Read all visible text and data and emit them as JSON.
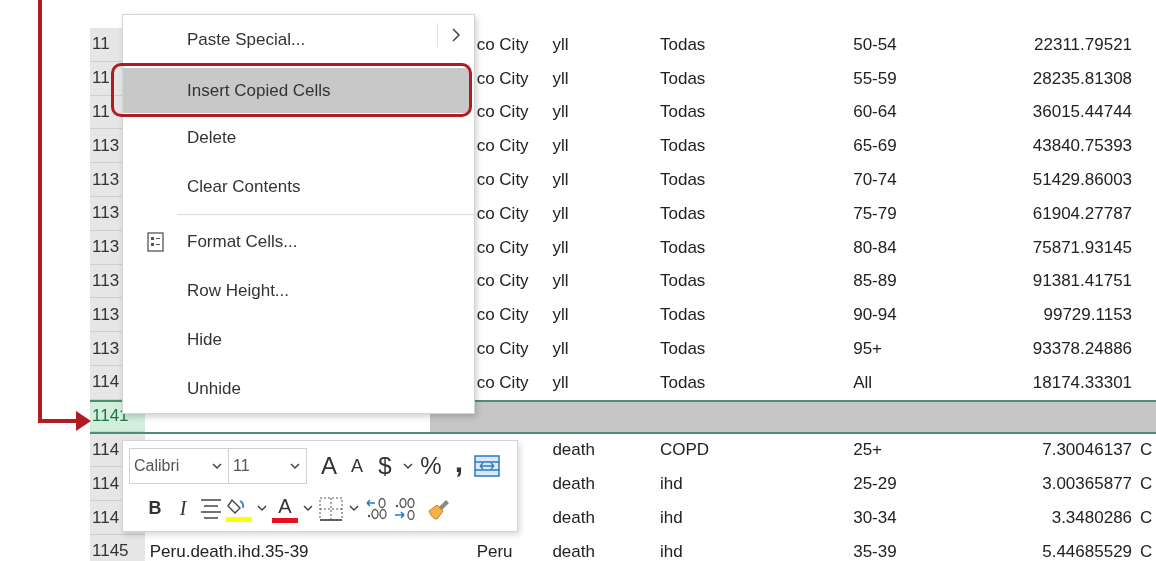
{
  "rows": [
    {
      "header": "11",
      "selected": false,
      "column_c": "co City",
      "column_d": "yll",
      "column_e": "Todas",
      "column_f": "50-54",
      "column_g": "22311.79521"
    },
    {
      "header": "11",
      "selected": false,
      "column_c": "co City",
      "column_d": "yll",
      "column_e": "Todas",
      "column_f": "55-59",
      "column_g": "28235.81308"
    },
    {
      "header": "11",
      "selected": false,
      "column_c": "co City",
      "column_d": "yll",
      "column_e": "Todas",
      "column_f": "60-64",
      "column_g": "36015.44744"
    },
    {
      "header": "113",
      "selected": false,
      "column_c": "co City",
      "column_d": "yll",
      "column_e": "Todas",
      "column_f": "65-69",
      "column_g": "43840.75393"
    },
    {
      "header": "113",
      "selected": false,
      "column_c": "co City",
      "column_d": "yll",
      "column_e": "Todas",
      "column_f": "70-74",
      "column_g": "51429.86003"
    },
    {
      "header": "113",
      "selected": false,
      "column_c": "co City",
      "column_d": "yll",
      "column_e": "Todas",
      "column_f": "75-79",
      "column_g": "61904.27787"
    },
    {
      "header": "113",
      "selected": false,
      "column_c": "co City",
      "column_d": "yll",
      "column_e": "Todas",
      "column_f": "80-84",
      "column_g": "75871.93145"
    },
    {
      "header": "113",
      "selected": false,
      "column_c": "co City",
      "column_d": "yll",
      "column_e": "Todas",
      "column_f": "85-89",
      "column_g": "91381.41751"
    },
    {
      "header": "113",
      "selected": false,
      "column_c": "co City",
      "column_d": "yll",
      "column_e": "Todas",
      "column_f": "90-94",
      "column_g": "99729.1153"
    },
    {
      "header": "113",
      "selected": false,
      "column_c": "co City",
      "column_d": "yll",
      "column_e": "Todas",
      "column_f": "95+",
      "column_g": "93378.24886"
    },
    {
      "header": "114",
      "selected": false,
      "column_c": "co City",
      "column_d": "yll",
      "column_e": "Todas",
      "column_f": "All",
      "column_g": "18174.33301"
    },
    {
      "header": "1141",
      "selected": true
    },
    {
      "header": "114",
      "selected": false,
      "column_d": "death",
      "column_e": "COPD",
      "column_f": "25+",
      "column_g": "7.30046137",
      "column_h": "C"
    },
    {
      "header": "114",
      "selected": false,
      "column_d": "death",
      "column_e": "ihd",
      "column_f": "25-29",
      "column_g": "3.00365877",
      "column_h": "C"
    },
    {
      "header": "114",
      "selected": false,
      "column_d": "death",
      "column_e": "ihd",
      "column_f": "30-34",
      "column_g": "3.3480286",
      "column_h": "C"
    },
    {
      "header": "1145",
      "selected": false,
      "column_b": "Peru.death.ihd.35-39",
      "column_c": "Peru",
      "column_d": "death",
      "column_e": "ihd",
      "column_f": "35-39",
      "column_g": "5.44685529",
      "column_h": "C"
    }
  ],
  "context_menu": {
    "items": [
      {
        "kind": "submenu",
        "label": "Paste Special...",
        "selected": false,
        "outlined": false,
        "has_icon": false
      },
      {
        "kind": "item",
        "label": "Insert Copied Cells",
        "selected": true,
        "outlined": true,
        "has_icon": false
      },
      {
        "kind": "item",
        "label": "Delete",
        "selected": false,
        "outlined": false,
        "has_icon": false
      },
      {
        "kind": "item",
        "label": "Clear Contents",
        "selected": false,
        "outlined": false,
        "has_icon": false
      },
      {
        "kind": "separator"
      },
      {
        "kind": "item",
        "label": "Format Cells...",
        "selected": false,
        "outlined": false,
        "has_icon": true
      },
      {
        "kind": "item",
        "label": "Row Height...",
        "selected": false,
        "outlined": false,
        "has_icon": false
      },
      {
        "kind": "item",
        "label": "Hide",
        "selected": false,
        "outlined": false,
        "has_icon": false
      },
      {
        "kind": "item",
        "label": "Unhide",
        "selected": false,
        "outlined": false,
        "has_icon": false
      }
    ]
  },
  "mini_toolbar": {
    "font": "Calibri",
    "size": "11",
    "row_1": [
      {
        "kind": "grow-font",
        "label": "A"
      },
      {
        "kind": "shrink-font",
        "label": "A"
      },
      {
        "kind": "text",
        "label": "$"
      },
      {
        "kind": "dropdown"
      },
      {
        "kind": "text",
        "label": "%"
      },
      {
        "kind": "comma",
        "label": ","
      },
      {
        "kind": "wrap"
      }
    ],
    "row_2": [
      {
        "kind": "bold",
        "label": "B"
      },
      {
        "kind": "italic",
        "label": "I"
      },
      {
        "kind": "align"
      },
      {
        "kind": "fill-color",
        "color": "#ffff00"
      },
      {
        "kind": "dropdown"
      },
      {
        "kind": "font-color",
        "label": "A",
        "color": "#e81123"
      },
      {
        "kind": "dropdown"
      },
      {
        "kind": "borders"
      },
      {
        "kind": "dropdown"
      },
      {
        "kind": "increase-decimal"
      },
      {
        "kind": "decrease-decimal"
      },
      {
        "kind": "format-painter"
      }
    ]
  }
}
